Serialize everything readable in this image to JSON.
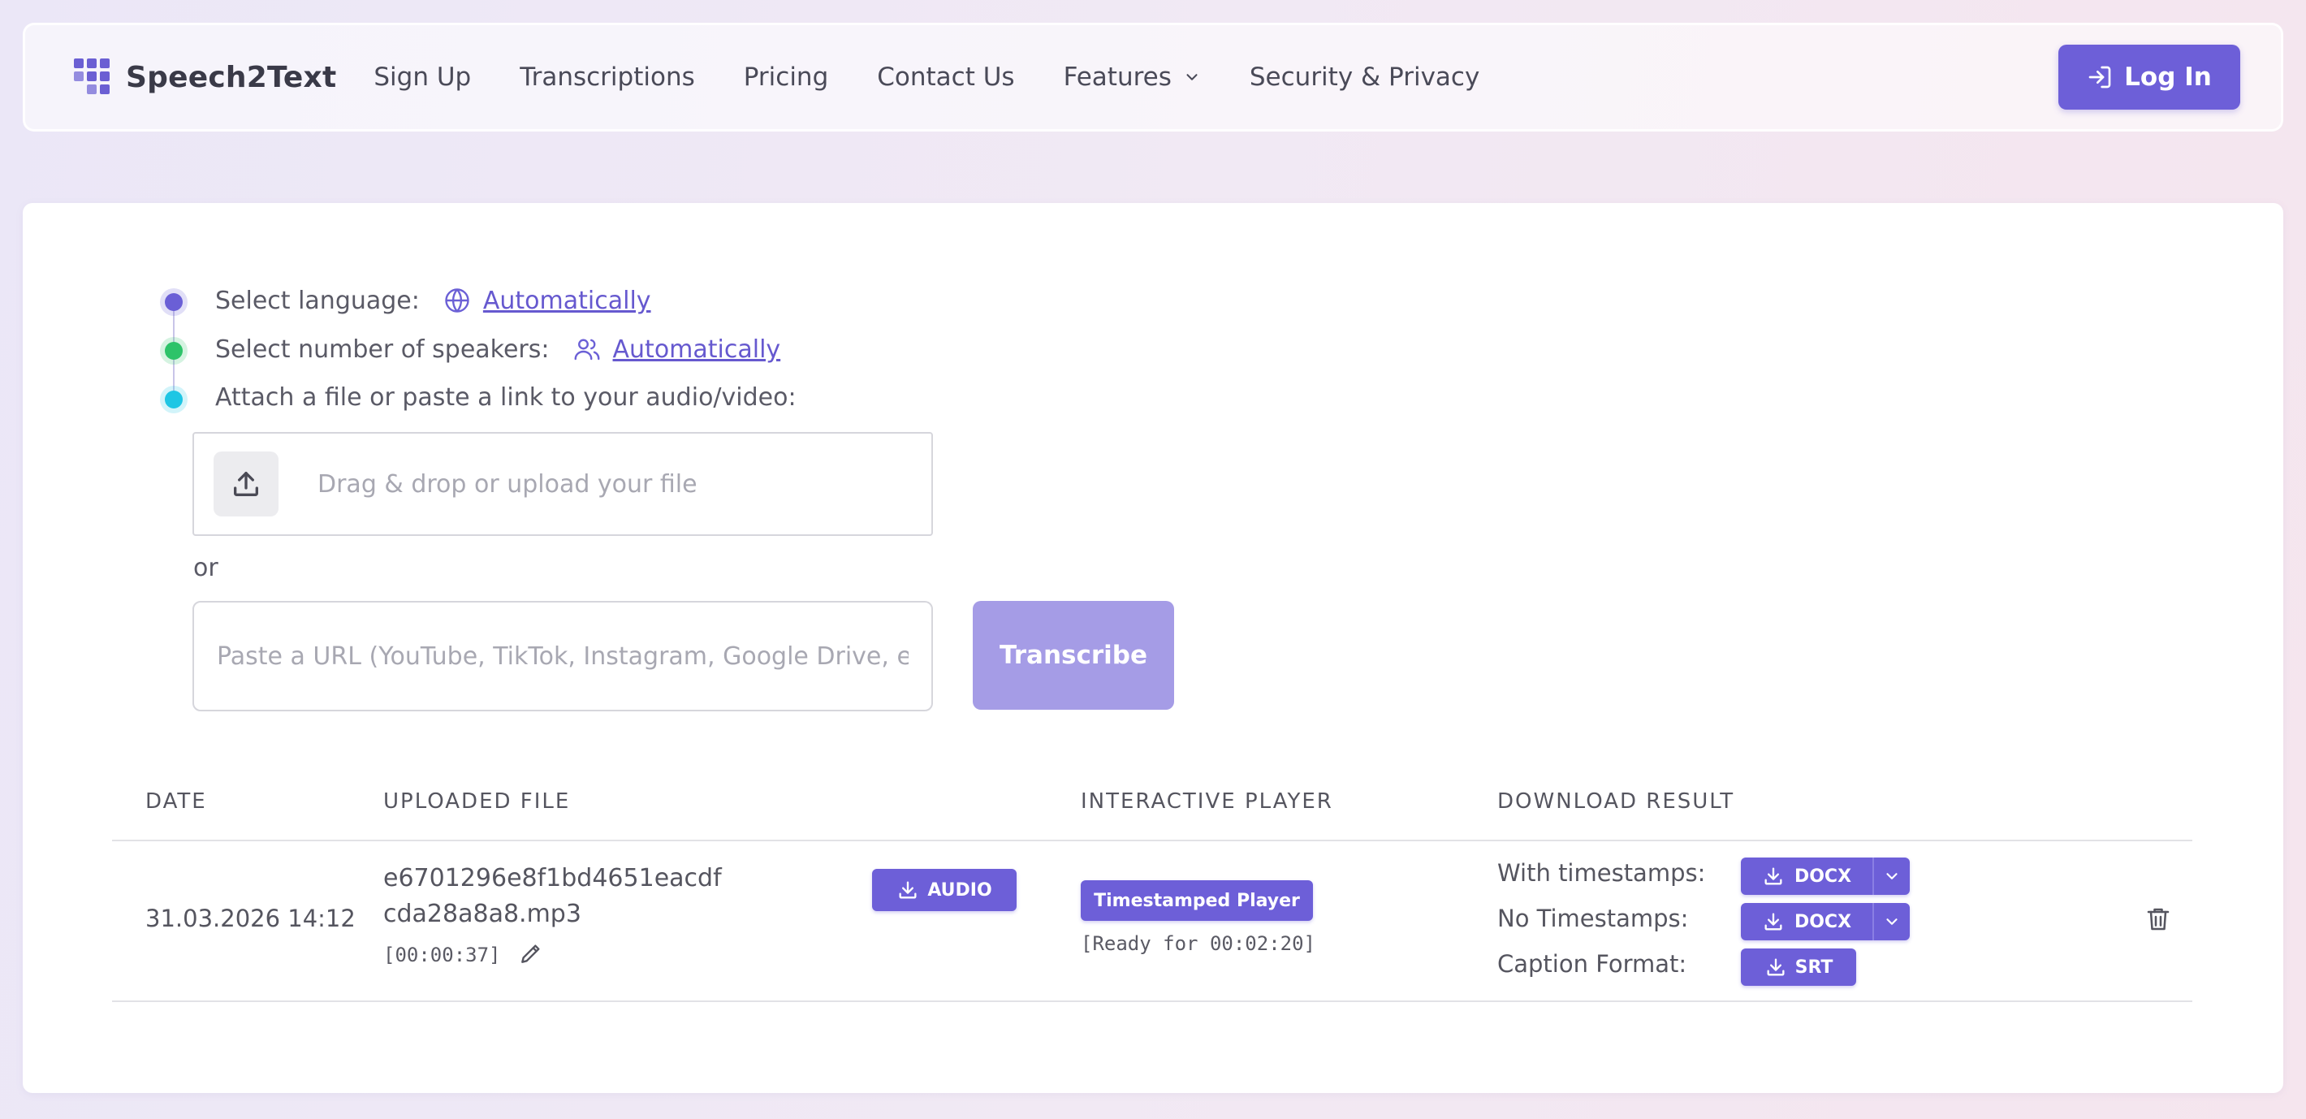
{
  "brand": {
    "name": "Speech2Text"
  },
  "nav": {
    "links": [
      "Sign Up",
      "Transcriptions",
      "Pricing",
      "Contact Us",
      "Features",
      "Security & Privacy"
    ],
    "login_label": "Log In"
  },
  "form": {
    "language_label": "Select language:",
    "language_value": "Automatically",
    "speakers_label": "Select number of speakers:",
    "speakers_value": "Automatically",
    "attach_label": "Attach a file or paste a link to your audio/video:",
    "upload_placeholder": "Drag & drop or upload your file",
    "or_text": "or",
    "url_placeholder": "Paste a URL (YouTube, TikTok, Instagram, Google Drive, etc.)",
    "transcribe_label": "Transcribe"
  },
  "table": {
    "headers": [
      "DATE",
      "UPLOADED FILE",
      "INTERACTIVE PLAYER",
      "DOWNLOAD RESULT"
    ],
    "rows": [
      {
        "date": "31.03.2026 14:12",
        "file_line1": "e6701296e8f1bd4651eacdf",
        "file_line2": "cda28a8a8.mp3",
        "duration": "[00:00:37]",
        "audio_label": "AUDIO",
        "player_label": "Timestamped Player",
        "player_status": "[Ready for 00:02:20]",
        "with_ts_label": "With timestamps:",
        "no_ts_label": "No Timestamps:",
        "caption_label": "Caption Format:",
        "docx_label": "DOCX",
        "srt_label": "SRT"
      }
    ]
  },
  "colors": {
    "accent": "#6d5fd8",
    "step1": "#6b60d6",
    "step2": "#2ec46a",
    "step3": "#1ec6e4"
  }
}
